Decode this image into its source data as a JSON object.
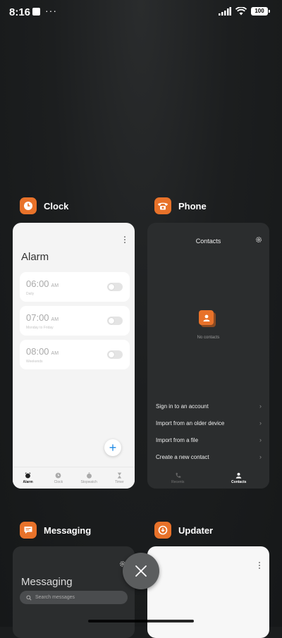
{
  "status_bar": {
    "time": "8:16",
    "overflow_dots": "···",
    "battery": "100"
  },
  "apps": {
    "clock": {
      "name": "Clock",
      "title": "Alarm",
      "alarms": [
        {
          "time": "06:00",
          "ampm": "AM",
          "label": "Daily",
          "enabled": false
        },
        {
          "time": "07:00",
          "ampm": "AM",
          "label": "Monday to Friday",
          "enabled": false
        },
        {
          "time": "08:00",
          "ampm": "AM",
          "label": "Weekends",
          "enabled": false
        }
      ],
      "tabs": [
        {
          "label": "Alarm",
          "icon": "alarm-icon",
          "active": true
        },
        {
          "label": "Clock",
          "icon": "clock-icon",
          "active": false
        },
        {
          "label": "Stopwatch",
          "icon": "stopwatch-icon",
          "active": false
        },
        {
          "label": "Timer",
          "icon": "hourglass-icon",
          "active": false
        }
      ]
    },
    "phone": {
      "name": "Phone",
      "title": "Contacts",
      "empty_text": "No contacts",
      "options": [
        "Sign in to an account",
        "Import from an older device",
        "Import from a file",
        "Create a new contact"
      ],
      "tabs": [
        {
          "label": "Recents",
          "icon": "phone-icon",
          "active": false
        },
        {
          "label": "Contacts",
          "icon": "person-icon",
          "active": true
        }
      ]
    },
    "messaging": {
      "name": "Messaging",
      "title": "Messaging",
      "search_placeholder": "Search messages"
    },
    "updater": {
      "name": "Updater"
    }
  },
  "colors": {
    "accent": "#e8722a",
    "fab_plus": "#1e88e5",
    "background": "#1b1d1e"
  }
}
